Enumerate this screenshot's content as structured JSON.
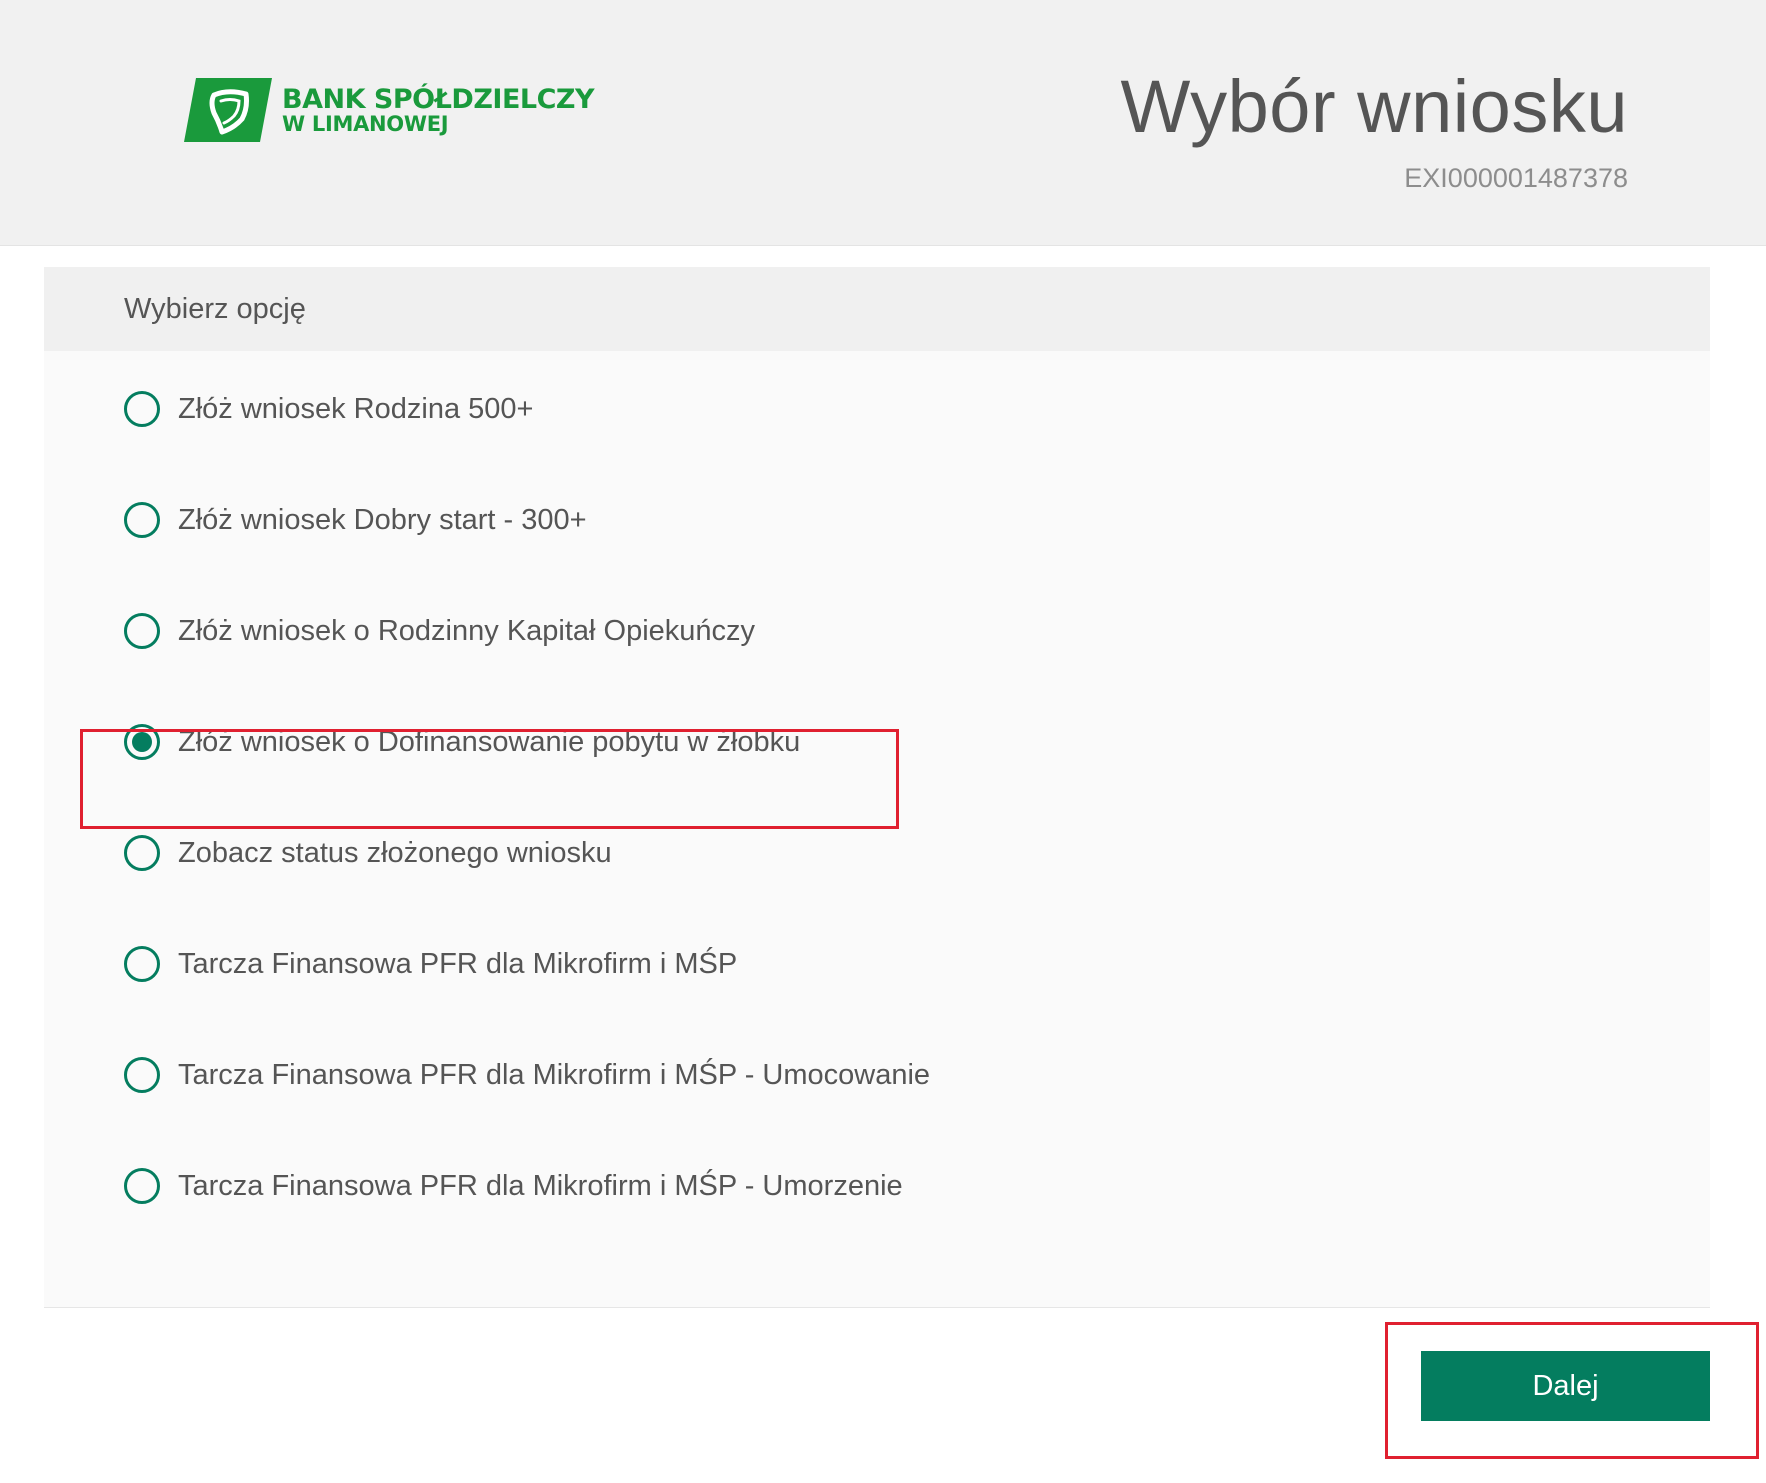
{
  "header": {
    "logo": {
      "line1": "BANK SPÓŁDZIELCZY",
      "line2": "W LIMANOWEJ",
      "color": "#1a9a3c"
    },
    "title": "Wybór wniosku",
    "application_id": "EXI000001487378"
  },
  "panel": {
    "title": "Wybierz opcję",
    "options": [
      {
        "label": "Złóż wniosek Rodzina 500+",
        "selected": false
      },
      {
        "label": "Złóż wniosek Dobry start - 300+",
        "selected": false
      },
      {
        "label": "Złóż wniosek o Rodzinny Kapitał Opiekuńczy",
        "selected": false
      },
      {
        "label": "Złóż wniosek o Dofinansowanie pobytu w żłobku",
        "selected": true
      },
      {
        "label": "Zobacz status złożonego wniosku",
        "selected": false
      },
      {
        "label": "Tarcza Finansowa PFR dla Mikrofirm i MŚP",
        "selected": false
      },
      {
        "label": "Tarcza Finansowa PFR dla Mikrofirm i MŚP - Umocowanie",
        "selected": false
      },
      {
        "label": "Tarcza Finansowa PFR dla Mikrofirm i MŚP - Umorzenie",
        "selected": false
      }
    ]
  },
  "footer": {
    "next_label": "Dalej"
  },
  "colors": {
    "accent": "#047d5f",
    "highlight": "#e02030",
    "header_bg": "#f1f1f1"
  }
}
